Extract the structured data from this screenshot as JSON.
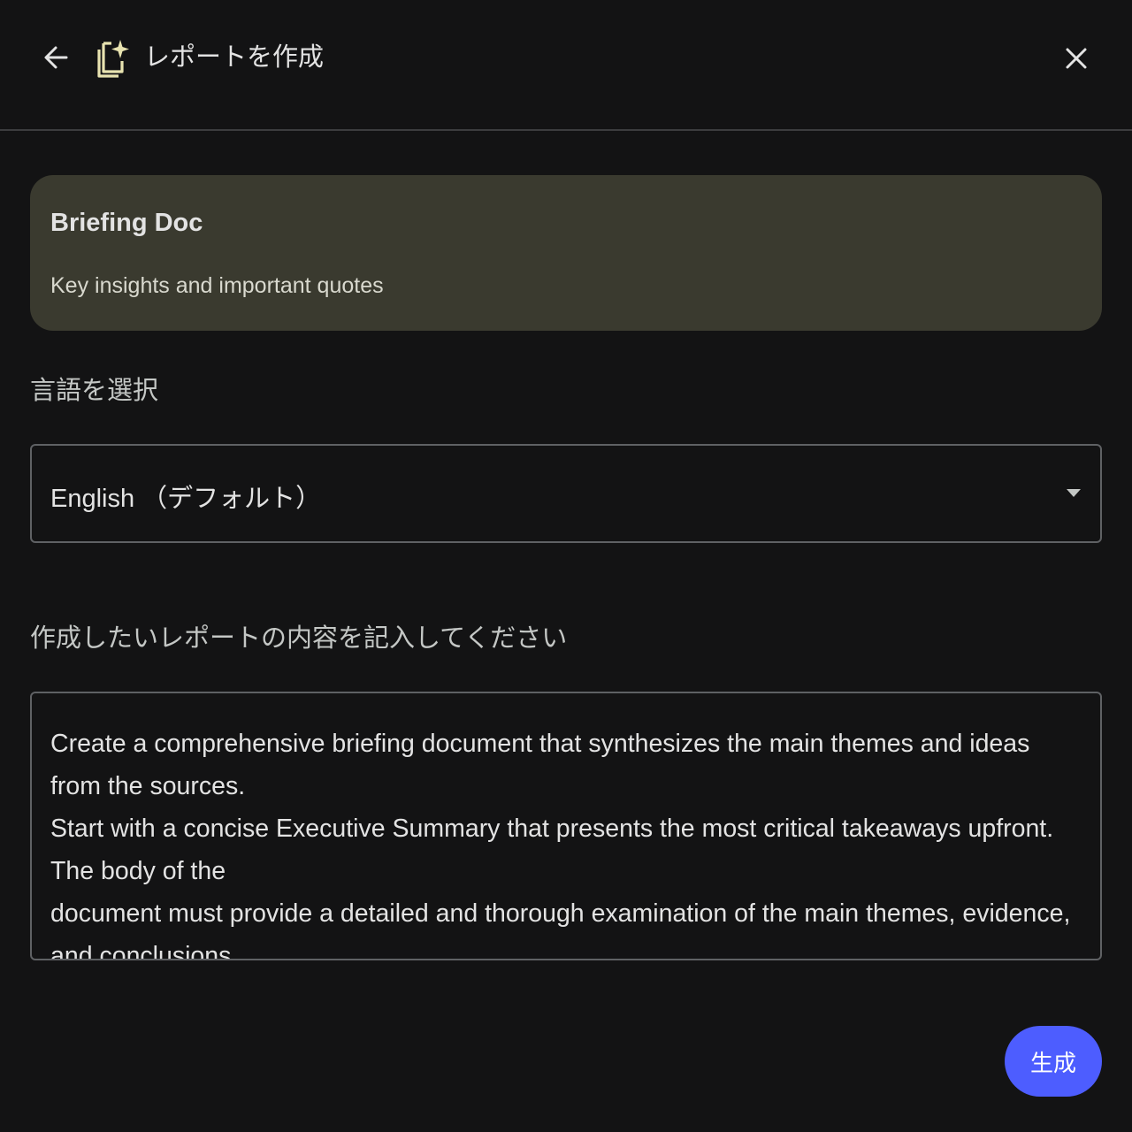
{
  "header": {
    "title": "レポートを作成",
    "back_icon": "arrow-left-icon",
    "title_icon": "report-sparkle-icon",
    "close_icon": "close-icon"
  },
  "card": {
    "title": "Briefing Doc",
    "description": "Key insights and important quotes",
    "background": "#3a3a2f"
  },
  "language": {
    "label": "言語を選択",
    "selected": "English （デフォルト）",
    "dropdown_icon": "triangle-down-icon"
  },
  "prompt": {
    "label": "作成したいレポートの内容を記入してください",
    "value": "Create a comprehensive briefing document that synthesizes the main themes and ideas from the sources.\nStart with a concise Executive Summary that presents the most critical takeaways upfront. The body of the\ndocument must provide a detailed and thorough examination of the main themes, evidence, and conclusions\nfound in the sources. This analysis should be structured logically with headings and bullet points to ensure\nclarity. The tone must be objective and incisive."
  },
  "actions": {
    "generate_label": "生成",
    "accent": "#4d5dff"
  }
}
